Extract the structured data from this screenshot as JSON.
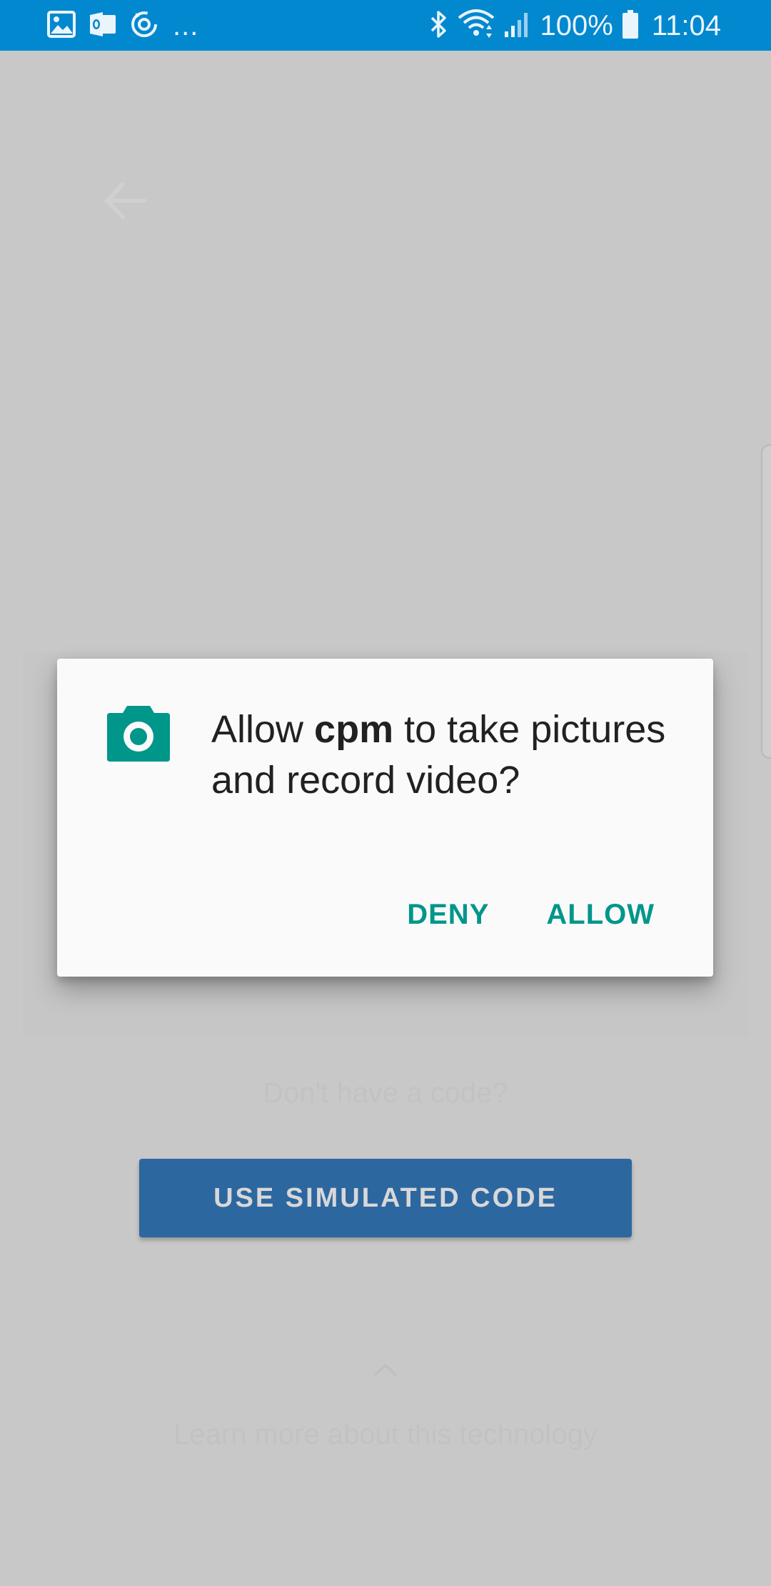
{
  "status_bar": {
    "notification_icons": [
      "gallery-icon",
      "outlook-icon",
      "sync-icon"
    ],
    "more_indicator": "...",
    "status_icons": [
      "bluetooth-icon",
      "wifi-icon",
      "signal-icon",
      "battery-icon"
    ],
    "battery_percent": "100%",
    "time": "11:04",
    "background_color": "#0288cf"
  },
  "background_app": {
    "back_icon": "arrow-back-icon",
    "no_code_text": "Don't have a code?",
    "simulate_button_label": "USE SIMULATED CODE",
    "expand_icon": "chevron-up-icon",
    "learn_more_text": "Learn more about this technology",
    "button_color": "#2d67a0"
  },
  "permission_dialog": {
    "icon": "camera-icon",
    "message_prefix": "Allow ",
    "app_name": "cpm",
    "message_suffix": " to take pictures and record video?",
    "deny_label": "DENY",
    "allow_label": "ALLOW",
    "accent_color": "#00968a"
  }
}
